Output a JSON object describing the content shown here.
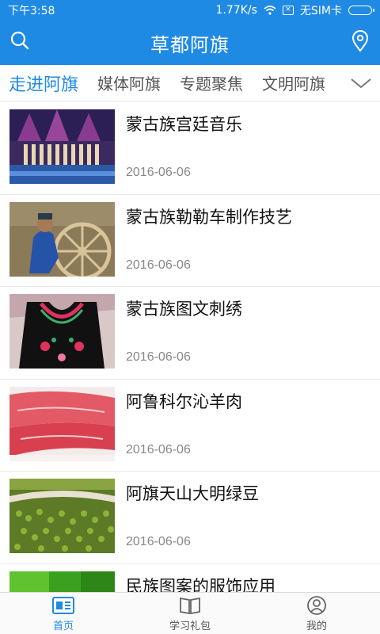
{
  "status_bar": {
    "time": "下午3:58",
    "speed": "1.77K/s",
    "sim": "无SIM卡"
  },
  "header": {
    "title": "草都阿旗",
    "search_icon": "search-icon",
    "location_icon": "location-pin-icon"
  },
  "tabs": [
    {
      "label": "走进阿旗",
      "active": true
    },
    {
      "label": "媒体阿旗",
      "active": false
    },
    {
      "label": "专题聚焦",
      "active": false
    },
    {
      "label": "文明阿旗",
      "active": false
    }
  ],
  "news": [
    {
      "title": "蒙古族宫廷音乐",
      "date": "2016-06-06",
      "image": "stage-performance"
    },
    {
      "title": "蒙古族勒勒车制作技艺",
      "date": "2016-06-06",
      "image": "cart-wheel-craftsman"
    },
    {
      "title": "蒙古族图文刺绣",
      "date": "2016-06-06",
      "image": "embroidered-garment"
    },
    {
      "title": "阿鲁科尔沁羊肉",
      "date": "2016-06-06",
      "image": "sliced-mutton"
    },
    {
      "title": "阿旗天山大明绿豆",
      "date": "2016-06-06",
      "image": "green-beans"
    },
    {
      "title": "民族图案的服饰应用",
      "date": "",
      "image": "green-pattern"
    }
  ],
  "bottom_nav": [
    {
      "label": "首页",
      "icon": "news-home-icon",
      "active": true
    },
    {
      "label": "学习礼包",
      "icon": "book-icon",
      "active": false
    },
    {
      "label": "我的",
      "icon": "user-icon",
      "active": false
    }
  ],
  "colors": {
    "primary": "#1f8ae4",
    "divider": "#e8e8e8",
    "date_text": "#888888"
  }
}
